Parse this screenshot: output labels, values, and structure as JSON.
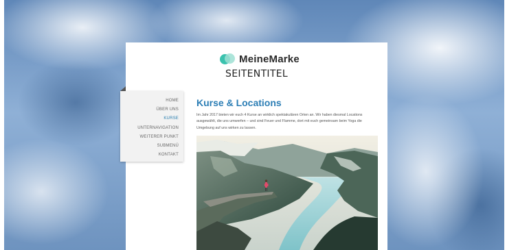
{
  "brand": {
    "name": "MeineMarke",
    "logo_icon": "overlapping-circles-logo",
    "logo_colors": [
      "#3bc2ae",
      "#9fe0d4"
    ]
  },
  "site_title": "SEITENTITEL",
  "nav": {
    "items": [
      {
        "label": "HOME",
        "active": false
      },
      {
        "label": "ÜBER UNS",
        "active": false
      },
      {
        "label": "KURSE",
        "active": true
      },
      {
        "label": "UNTERNAVIGATION",
        "active": false
      },
      {
        "label": "WEITERER PUNKT",
        "active": false
      },
      {
        "label": "SUBMENÜ",
        "active": false
      },
      {
        "label": "KONTAKT",
        "active": false
      }
    ],
    "active_color": "#2a7fb0"
  },
  "main": {
    "heading": "Kurse & Locations",
    "intro": "Im Jahr 2017 bieten wir euch 4 Kurse an wirklich spektakulären Orten an. Wir haben diesmal Locations ausgewählt, die uns umwerfen – und sind Feuer und Flamme, dort mit euch gemeinsam beim Yoga die Umgebung auf uns wirken zu lassen.",
    "heading_color": "#2c7eb5"
  },
  "photo": {
    "subject": "fjord-cliff-landscape-image"
  }
}
